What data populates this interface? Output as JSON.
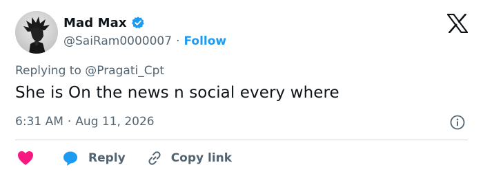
{
  "author": {
    "display_name": "Mad Max",
    "handle": "@SaiRam0000007",
    "separator": "·",
    "follow_label": "Follow"
  },
  "tweet": {
    "replying_to": "Replying to @Pragati_Cpt",
    "text": "She is On the news n social every where",
    "time": "6:31 AM",
    "date": "Aug 11, 2026"
  },
  "actions": {
    "reply_label": "Reply",
    "copy_link_label": "Copy link"
  },
  "colors": {
    "accent": "#1d9bf0",
    "like": "#f91880",
    "secondary_text": "#536471"
  },
  "icons": [
    "verified-badge-icon",
    "x-logo-icon",
    "info-icon",
    "heart-icon",
    "reply-bubble-icon",
    "link-icon"
  ]
}
